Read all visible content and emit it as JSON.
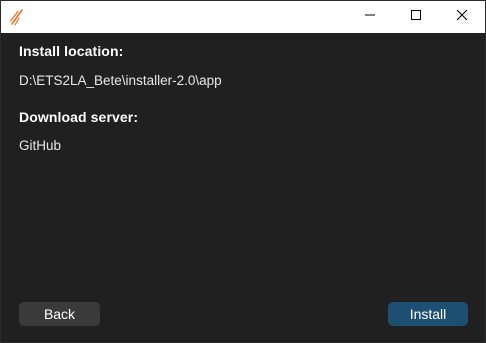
{
  "window": {
    "controls": {
      "minimize_icon": "minimize-icon",
      "maximize_icon": "maximize-icon",
      "close_icon": "close-icon"
    },
    "app_icon": "app-logo-icon"
  },
  "form": {
    "install_location_label": "Install location:",
    "install_location_value": "D:\\ETS2LA_Bete\\installer-2.0\\app",
    "download_server_label": "Download server:",
    "download_server_value": "GitHub"
  },
  "footer": {
    "back_label": "Back",
    "install_label": "Install"
  },
  "colors": {
    "background": "#202020",
    "titlebar": "#ffffff",
    "back_button": "#3a3a3a",
    "install_button": "#1d4f72",
    "app_icon_accent": "#e8742a"
  }
}
